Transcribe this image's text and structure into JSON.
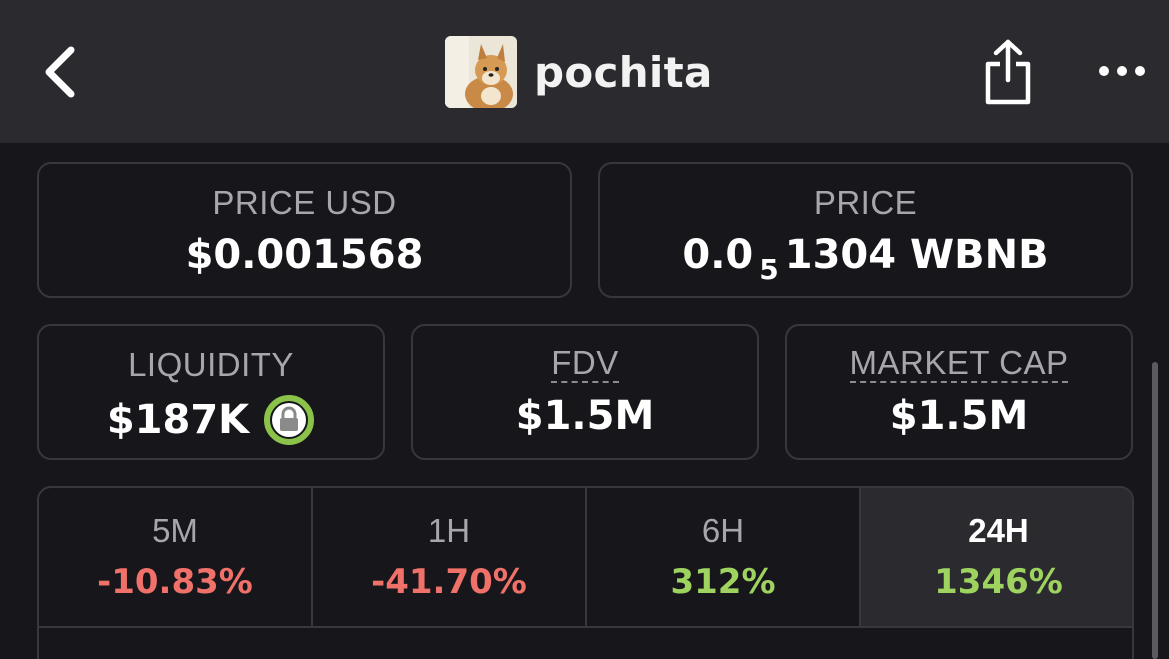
{
  "header": {
    "title": "pochita",
    "back_icon": "chevron-left-icon",
    "share_icon": "share-icon",
    "more_icon": "more-horizontal-icon"
  },
  "price_usd": {
    "label": "PRICE USD",
    "value": "$0.001568"
  },
  "price": {
    "label": "PRICE",
    "value_prefix": "0.0",
    "value_subscript": "5",
    "value_suffix": "1304 WBNB"
  },
  "liquidity": {
    "label": "LIQUIDITY",
    "value": "$187K",
    "lock_icon": "lock-icon"
  },
  "fdv": {
    "label": "FDV",
    "value": "$1.5M"
  },
  "market_cap": {
    "label": "MARKET CAP",
    "value": "$1.5M"
  },
  "changes": [
    {
      "label": "5M",
      "value": "-10.83%",
      "trend": "negative"
    },
    {
      "label": "1H",
      "value": "-41.70%",
      "trend": "negative"
    },
    {
      "label": "6H",
      "value": "312%",
      "trend": "positive"
    },
    {
      "label": "24H",
      "value": "1346%",
      "trend": "positive",
      "active": true
    }
  ],
  "colors": {
    "background": "#17171b",
    "header": "#2a2a2f",
    "negative": "#f0706a",
    "positive": "#9fd35f",
    "lock_ring": "#8bc34a"
  }
}
